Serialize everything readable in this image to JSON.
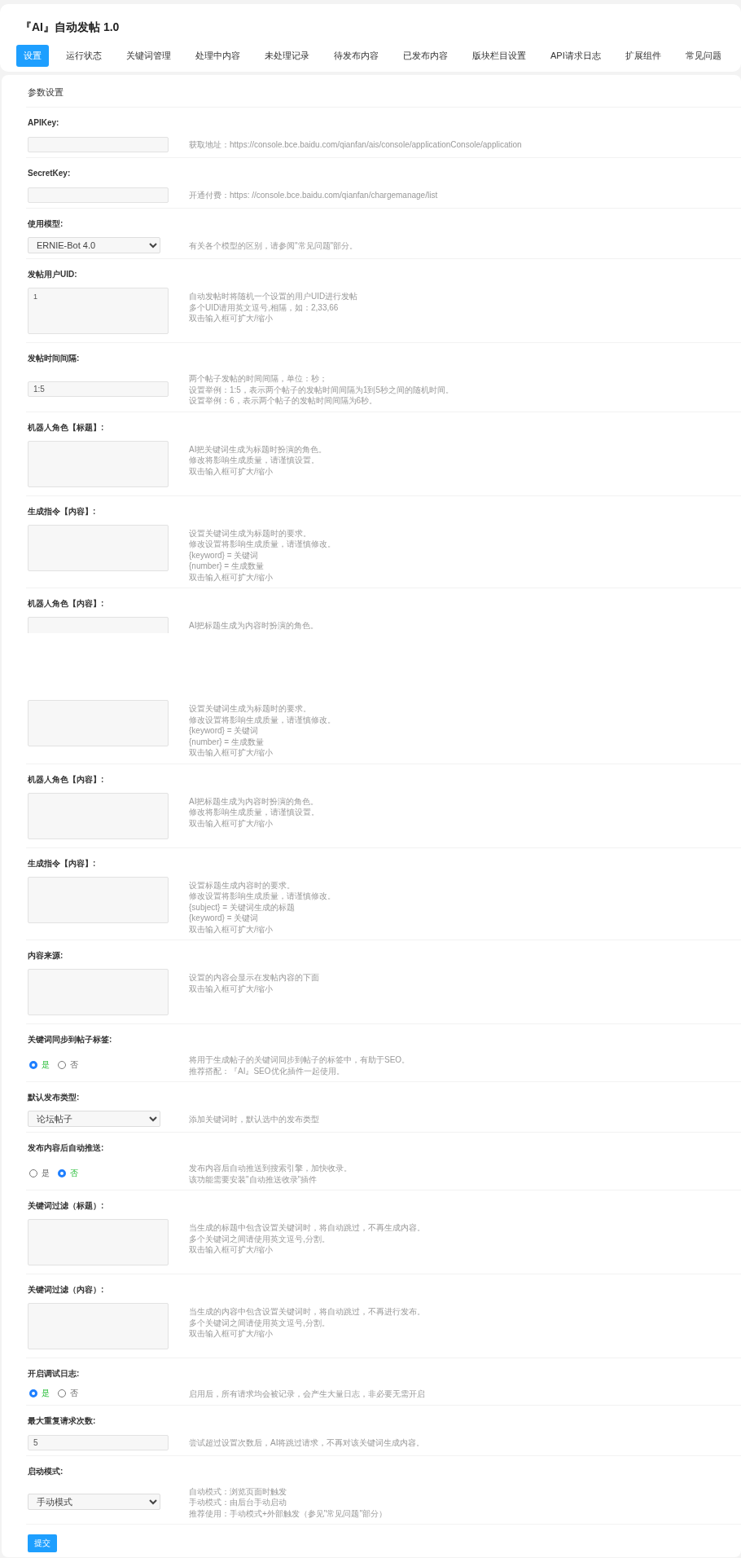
{
  "title": "『AI』自动发帖 1.0",
  "tabs": [
    {
      "label": "设置",
      "selected": true
    },
    {
      "label": "运行状态",
      "selected": false
    },
    {
      "label": "关键词管理",
      "selected": false
    },
    {
      "label": "处理中内容",
      "selected": false
    },
    {
      "label": "未处理记录",
      "selected": false
    },
    {
      "label": "待发布内容",
      "selected": false
    },
    {
      "label": "已发布内容",
      "selected": false
    },
    {
      "label": "版块栏目设置",
      "selected": false
    },
    {
      "label": "API请求日志",
      "selected": false
    },
    {
      "label": "扩展组件",
      "selected": false
    },
    {
      "label": "常见问题",
      "selected": false
    }
  ],
  "section_title": "参数设置",
  "rows": [
    {
      "label": "APIKey:",
      "kind": "input",
      "help": [
        "获取地址：https://console.bce.baidu.com/qianfan/ais/console/applicationConsole/application"
      ]
    },
    {
      "label": "SecretKey:",
      "kind": "input",
      "help": [
        "开通付费：https: //console.bce.baidu.com/qianfan/chargemanage/list"
      ]
    },
    {
      "label": "使用模型:",
      "kind": "select",
      "value": "ERNIE-Bot 4.0",
      "help": [
        "有关各个模型的区别，请参阅\"常见问题\"部分。"
      ]
    },
    {
      "label": "发帖用户UID:",
      "kind": "textarea",
      "value": "1",
      "help": [
        "自动发帖时将随机一个设置的用户UID进行发帖",
        "多个UID请用英文逗号,相隔，如：2,33,66",
        "双击输入框可扩大/缩小"
      ]
    },
    {
      "label": "发帖时间间隔:",
      "kind": "input",
      "value": "1:5",
      "help": [
        "两个帖子发帖的时间间隔，单位：秒；",
        "设置举例：1:5，表示两个帖子的发帖时间间隔为1到5秒之间的随机时间。",
        "设置举例：6，表示两个帖子的发帖时间间隔为6秒。"
      ]
    },
    {
      "label": "机器人角色【标题】:",
      "kind": "textarea",
      "help": [
        "AI把关键词生成为标题时扮演的角色。",
        "修改将影响生成质量，请谨慎设置。",
        "双击输入框可扩大/缩小"
      ]
    },
    {
      "label": "生成指令【内容】:",
      "kind": "textarea",
      "help": [
        "设置关键词生成为标题时的要求。",
        "修改设置将影响生成质量，请谨慎修改。",
        "{keyword} = 关键词",
        "{number} = 生成数量",
        "双击输入框可扩大/缩小"
      ]
    },
    {
      "label": "机器人角色【内容】:",
      "kind": "textarea",
      "clipped": true,
      "help": [
        "AI把标题生成为内容时扮演的角色。"
      ]
    },
    {
      "kind": "textarea",
      "help": [
        "设置关键词生成为标题时的要求。",
        "修改设置将影响生成质量，请谨慎修改。",
        "{keyword} = 关键词",
        "{number} = 生成数量",
        "双击输入框可扩大/缩小"
      ]
    },
    {
      "label": "机器人角色【内容】:",
      "kind": "textarea",
      "help": [
        "AI把标题生成为内容时扮演的角色。",
        "修改将影响生成质量，请谨慎设置。",
        "双击输入框可扩大/缩小"
      ]
    },
    {
      "label": "生成指令【内容】:",
      "kind": "textarea",
      "help": [
        "设置标题生成内容时的要求。",
        "修改设置将影响生成质量，请谨慎修改。",
        "{subject} = 关键词生成的标题",
        "{keyword} = 关键词",
        "双击输入框可扩大/缩小"
      ]
    },
    {
      "label": "内容来源:",
      "kind": "textarea",
      "help": [
        "设置的内容会显示在发帖内容的下面",
        "双击输入框可扩大/缩小"
      ]
    },
    {
      "label": "关键词同步到帖子标签:",
      "kind": "radio",
      "options": [
        {
          "label": "是",
          "selected": true
        },
        {
          "label": "否",
          "selected": false
        }
      ],
      "help": [
        "将用于生成帖子的关键词同步到帖子的标签中，有助于SEO。",
        "推荐搭配：『AI』SEO优化插件一起使用。"
      ]
    },
    {
      "label": "默认发布类型:",
      "kind": "select",
      "value": "论坛帖子",
      "help": [
        "添加关键词时，默认选中的发布类型"
      ]
    },
    {
      "label": "发布内容后自动推送:",
      "kind": "radio",
      "options": [
        {
          "label": "是",
          "selected": false
        },
        {
          "label": "否",
          "selected": true
        }
      ],
      "help": [
        "发布内容后自动推送到搜索引擎，加快收录。",
        "该功能需要安装\"自动推送收录\"插件"
      ]
    },
    {
      "label": "关键词过滤（标题）:",
      "kind": "textarea",
      "help": [
        "当生成的标题中包含设置关键词时，将自动跳过，不再生成内容。",
        "多个关键词之间请使用英文逗号,分割。",
        "双击输入框可扩大/缩小"
      ]
    },
    {
      "label": "关键词过滤（内容）:",
      "kind": "textarea",
      "help": [
        "当生成的内容中包含设置关键词时，将自动跳过，不再进行发布。",
        "多个关键词之间请使用英文逗号,分割。",
        "双击输入框可扩大/缩小"
      ]
    },
    {
      "label": "开启调试日志:",
      "kind": "radio",
      "options": [
        {
          "label": "是",
          "selected": true
        },
        {
          "label": "否",
          "selected": false
        }
      ],
      "help": [
        "启用后，所有请求均会被记录，会产生大量日志，非必要无需开启"
      ]
    },
    {
      "label": "最大重复请求次数:",
      "kind": "input",
      "value": "5",
      "help": [
        "尝试超过设置次数后，AI将跳过请求，不再对该关键词生成内容。"
      ]
    },
    {
      "label": "启动模式:",
      "kind": "select",
      "value": "手动模式",
      "help": [
        "自动模式：浏览页面时触发",
        "手动模式：由后台手动启动",
        "推荐使用：手动模式+外部触发（参见\"常见问题\"部分）"
      ]
    }
  ],
  "submit": "提交"
}
